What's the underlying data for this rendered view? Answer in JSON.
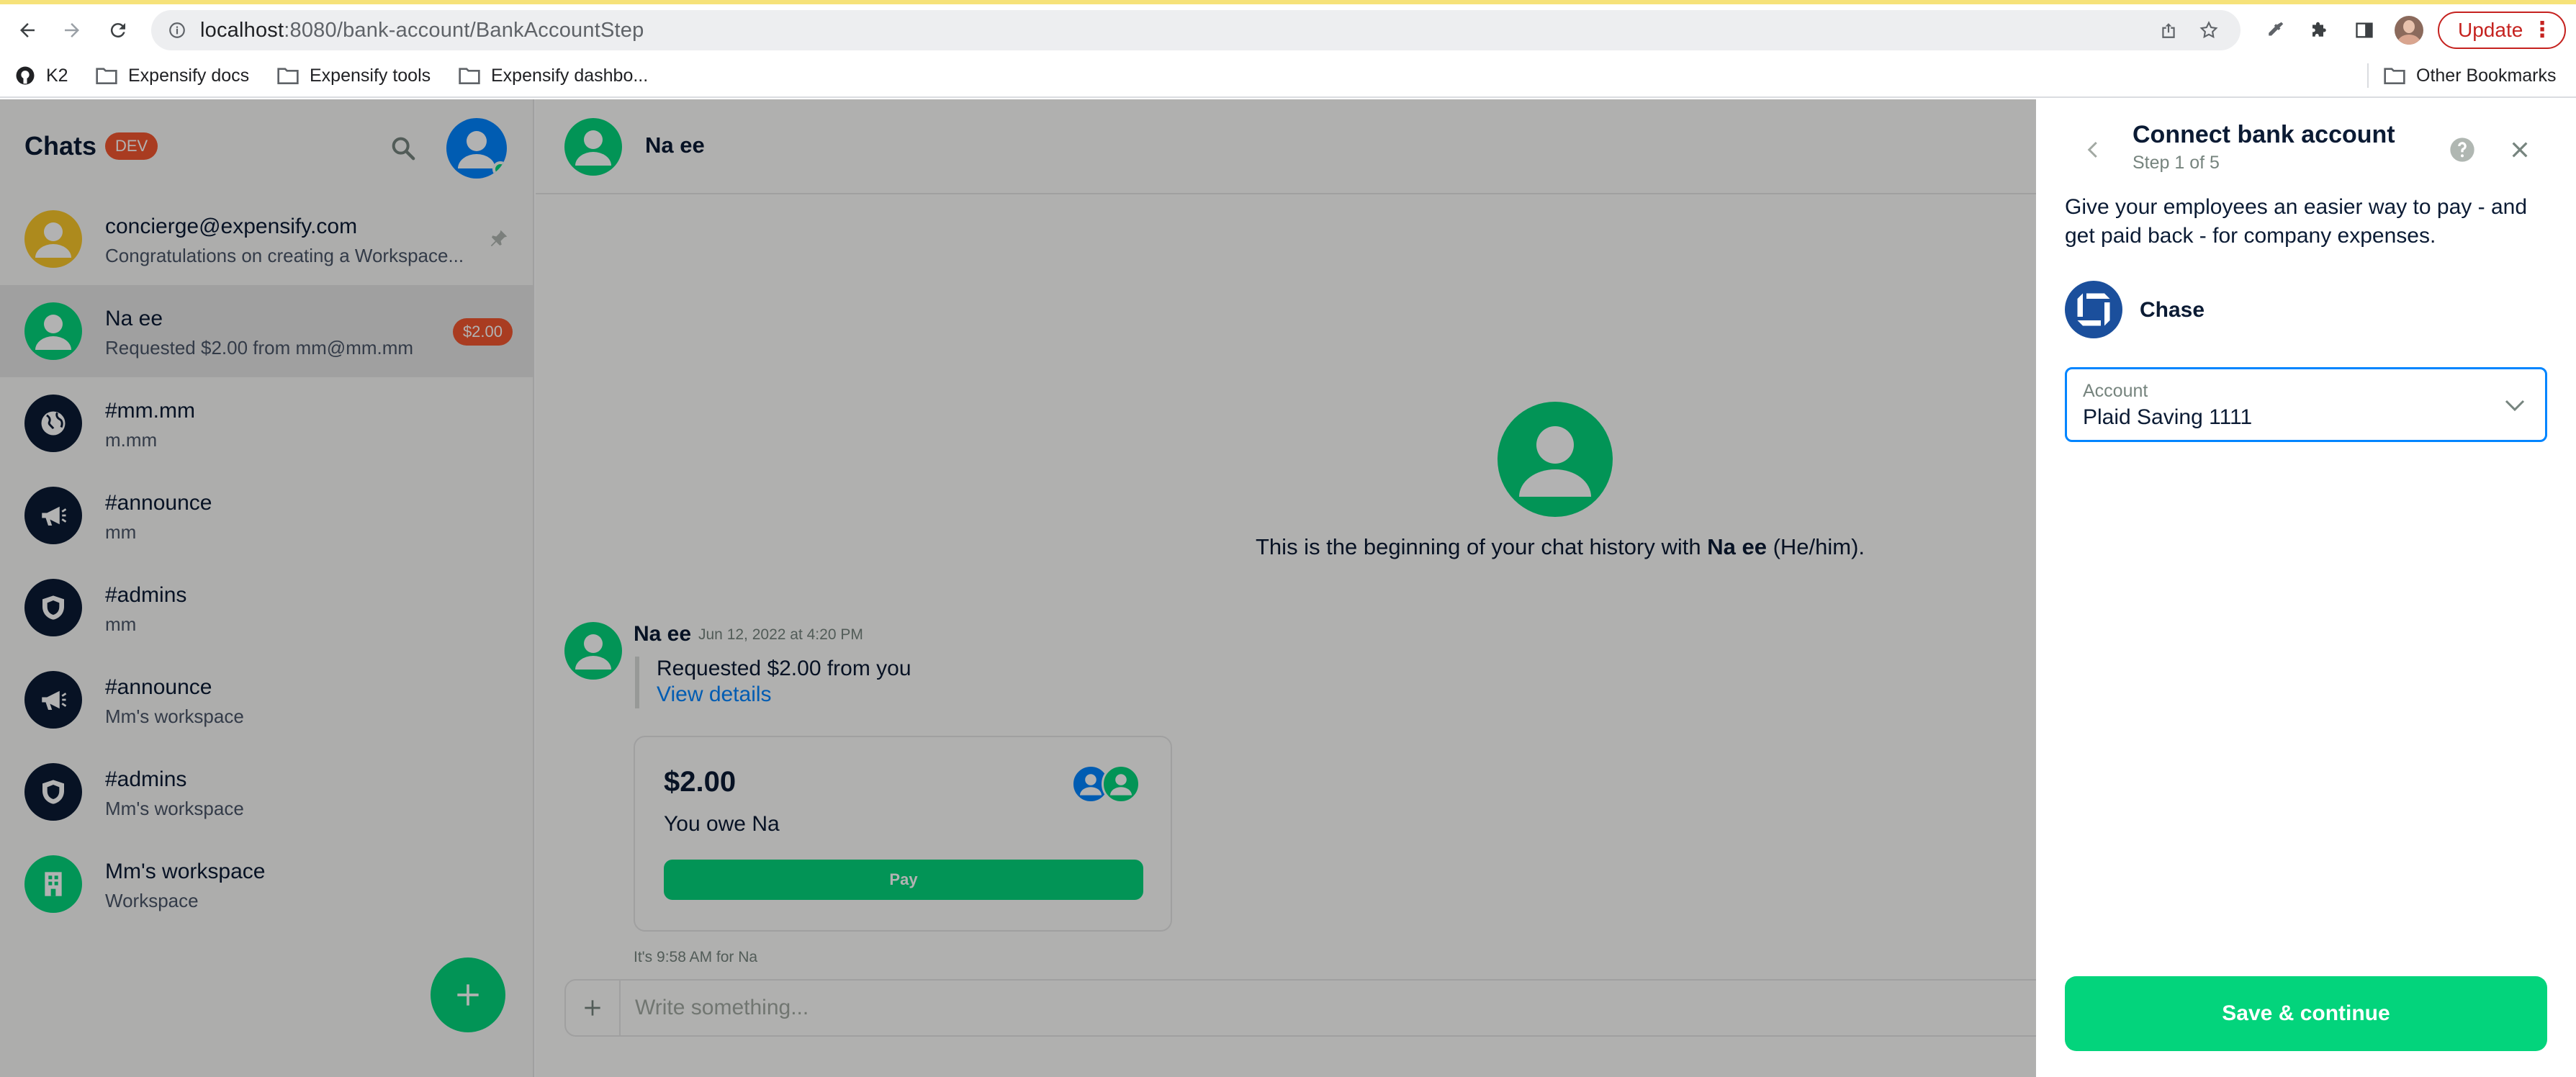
{
  "browser": {
    "url_host": "localhost",
    "url_rest": ":8080/bank-account/BankAccountStep",
    "update_label": "Update",
    "bookmarks": [
      {
        "label": "K2",
        "icon": "github-icon"
      },
      {
        "label": "Expensify docs",
        "icon": "folder-icon"
      },
      {
        "label": "Expensify tools",
        "icon": "folder-icon"
      },
      {
        "label": "Expensify dashbo...",
        "icon": "folder-icon"
      },
      {
        "label": "Other Bookmarks",
        "icon": "folder-icon"
      }
    ]
  },
  "sidebar": {
    "title": "Chats",
    "env_badge": "DEV",
    "chats": [
      {
        "name": "concierge@expensify.com",
        "subtitle": "Congratulations on creating a Workspace...",
        "avatar": "concierge-avatar",
        "pinned": true
      },
      {
        "name": "Na ee",
        "subtitle": "Requested $2.00 from mm@mm.mm",
        "avatar": "user-avatar",
        "badge": "$2.00",
        "active": true
      },
      {
        "name": "#mm.mm",
        "subtitle": "m.mm",
        "avatar": "globe-icon"
      },
      {
        "name": "#announce",
        "subtitle": "mm",
        "avatar": "megaphone-icon"
      },
      {
        "name": "#admins",
        "subtitle": "mm",
        "avatar": "shield-icon"
      },
      {
        "name": "#announce",
        "subtitle": "Mm's workspace",
        "avatar": "megaphone-icon"
      },
      {
        "name": "#admins",
        "subtitle": "Mm's workspace",
        "avatar": "shield-icon"
      },
      {
        "name": "Mm's workspace",
        "subtitle": "Workspace",
        "avatar": "building-icon"
      }
    ]
  },
  "chat": {
    "header_name": "Na ee",
    "welcome_prefix": "This is the beginning of your chat history with ",
    "welcome_name": "Na ee",
    "welcome_suffix": " (He/him).",
    "message": {
      "author": "Na ee",
      "timestamp": "Jun 12, 2022 at 4:20 PM",
      "text": "Requested $2.00 from you",
      "link": "View details"
    },
    "iou": {
      "amount": "$2.00",
      "description": "You owe Na",
      "pay_label": "Pay"
    },
    "local_time": "It's 9:58 AM for Na",
    "composer_placeholder": "Write something..."
  },
  "panel": {
    "title": "Connect bank account",
    "step": "Step 1 of 5",
    "description": "Give your employees an easier way to pay - and get paid back - for company expenses.",
    "bank_name": "Chase",
    "account_label": "Account",
    "account_value": "Plaid Saving 1111",
    "save_label": "Save & continue"
  },
  "colors": {
    "accent_green": "#03d47c",
    "link_blue": "#0185ff",
    "badge_red": "#f25730",
    "chase_blue": "#1b4f9c"
  }
}
